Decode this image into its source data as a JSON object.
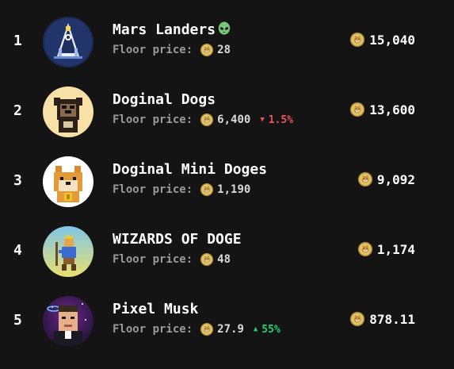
{
  "floor_label": "Floor price:",
  "collections": [
    {
      "rank": "1",
      "name": "Mars Landers",
      "name_icon": "alien-emoji-icon",
      "floor_price": "28",
      "change": null,
      "volume": "15,040",
      "avatar": "mars-landers-avatar"
    },
    {
      "rank": "2",
      "name": "Doginal Dogs",
      "name_icon": null,
      "floor_price": "6,400",
      "change": {
        "direction": "down",
        "value": "1.5%"
      },
      "volume": "13,600",
      "avatar": "doginal-dogs-avatar"
    },
    {
      "rank": "3",
      "name": "Doginal Mini Doges",
      "name_icon": null,
      "floor_price": "1,190",
      "change": null,
      "volume": "9,092",
      "avatar": "doginal-mini-doges-avatar"
    },
    {
      "rank": "4",
      "name": "WIZARDS OF DOGE",
      "name_icon": null,
      "floor_price": "48",
      "change": null,
      "volume": "1,174",
      "avatar": "wizards-of-doge-avatar"
    },
    {
      "rank": "5",
      "name": "Pixel Musk",
      "name_icon": null,
      "floor_price": "27.9",
      "change": {
        "direction": "up",
        "value": "55%"
      },
      "volume": "878.11",
      "avatar": "pixel-musk-avatar"
    }
  ],
  "colors": {
    "background": "#141414",
    "text": "#ffffff",
    "muted": "#9a9a9a",
    "negative": "#f0505a",
    "positive": "#19d27a",
    "coin": "#c9a63c"
  }
}
